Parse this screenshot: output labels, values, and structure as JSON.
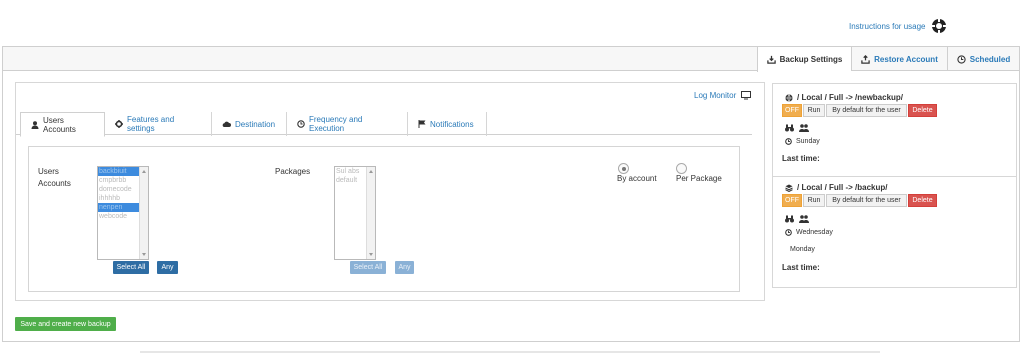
{
  "header": {
    "instructions_link": "Instructions for usage"
  },
  "top_tabs": [
    {
      "label": "Backup Settings",
      "icon": "download-tray-icon",
      "active": true
    },
    {
      "label": "Restore Account",
      "icon": "upload-tray-icon",
      "active": false
    },
    {
      "label": "Scheduled",
      "icon": "clock-icon",
      "active": false
    }
  ],
  "log_monitor": {
    "label": "Log Monitor",
    "icon": "monitor-icon"
  },
  "inner_tabs": [
    {
      "label": "Users Accounts",
      "icon": "user-icon",
      "active": true
    },
    {
      "label": "Features and settings",
      "icon": "gear-icon",
      "active": false
    },
    {
      "label": "Destination",
      "icon": "cloud-icon",
      "active": false
    },
    {
      "label": "Frequency and Execution",
      "icon": "clock-icon",
      "active": false
    },
    {
      "label": "Notifications",
      "icon": "flag-icon",
      "active": false
    }
  ],
  "form": {
    "users_label": "Users Accounts",
    "users_options": [
      {
        "label": "backbiuit",
        "selected": true
      },
      {
        "label": "cmpbrbb",
        "selected": false
      },
      {
        "label": "domecode",
        "selected": false
      },
      {
        "label": "ihhhhb",
        "selected": false
      },
      {
        "label": "nenpen",
        "selected": true
      },
      {
        "label": "webcode",
        "selected": false
      }
    ],
    "users_select_all": "Select All",
    "users_any": "Any",
    "packages_label": "Packages",
    "packages_options": [
      {
        "label": "Sul abs",
        "selected": false
      },
      {
        "label": "default",
        "selected": false
      }
    ],
    "packages_select_all": "Select All",
    "packages_any": "Any",
    "radio_by_account": "By account",
    "radio_per_package": "Per Package",
    "radio_selected": "By account"
  },
  "save_button": "Save and create new backup",
  "schedules": [
    {
      "title": "/ Local / Full -> /newbackup/",
      "icon": "globe-icon",
      "off": "OFF",
      "run": "Run",
      "default": "By default for the user",
      "delete": "Delete",
      "day": "Sunday",
      "extra_day": "",
      "last_time_label": "Last time:"
    },
    {
      "title": "/ Local / Full -> /backup/",
      "icon": "layers-icon",
      "off": "OFF",
      "run": "Run",
      "default": "By default for the user",
      "delete": "Delete",
      "day": "Wednesday",
      "extra_day": "Monday",
      "last_time_label": "Last time:"
    }
  ],
  "colors": {
    "link": "#2a7ab8",
    "primary": "#2e6da4",
    "success": "#4fae4a",
    "warning": "#f0ad4e",
    "danger": "#d9534f"
  }
}
